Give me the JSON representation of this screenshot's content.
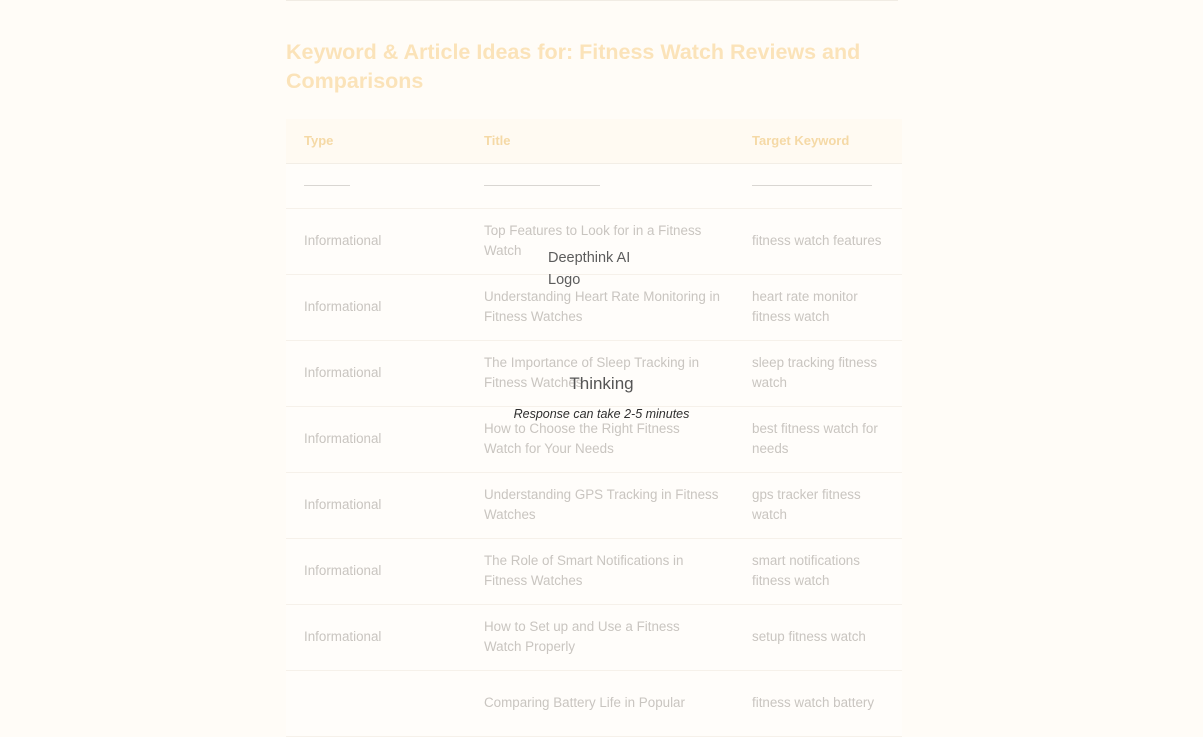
{
  "page": {
    "title": "Keyword & Article Ideas for: Fitness Watch Reviews and Comparisons"
  },
  "table": {
    "headers": [
      "Type",
      "Title",
      "Target Keyword"
    ],
    "rows": [
      {
        "type": "Informational",
        "title": "Top Features to Look for in a Fitness Watch",
        "keyword": "fitness watch features"
      },
      {
        "type": "Informational",
        "title": "Understanding Heart Rate Monitoring in Fitness Watches",
        "keyword": "heart rate monitor fitness watch"
      },
      {
        "type": "Informational",
        "title": "The Importance of Sleep Tracking in Fitness Watches",
        "keyword": "sleep tracking fitness watch"
      },
      {
        "type": "Informational",
        "title": "How to Choose the Right Fitness Watch for Your Needs",
        "keyword": "best fitness watch for needs"
      },
      {
        "type": "Informational",
        "title": "Understanding GPS Tracking in Fitness Watches",
        "keyword": "gps tracker fitness watch"
      },
      {
        "type": "Informational",
        "title": "The Role of Smart Notifications in Fitness Watches",
        "keyword": "smart notifications fitness watch"
      },
      {
        "type": "Informational",
        "title": "How to Set up and Use a Fitness Watch Properly",
        "keyword": "setup fitness watch"
      },
      {
        "type": "",
        "title": "Comparing Battery Life in Popular",
        "keyword": "fitness watch battery"
      }
    ]
  },
  "overlay": {
    "logo_alt": "Deepthink AI Logo",
    "status": "Thinking",
    "note": "Response can take 2-5 minutes"
  },
  "colors": {
    "title": "#fbe3b9",
    "header_text": "#f5d9a6",
    "cell_text": "#c9c5c0",
    "background": "#fffcf7"
  }
}
